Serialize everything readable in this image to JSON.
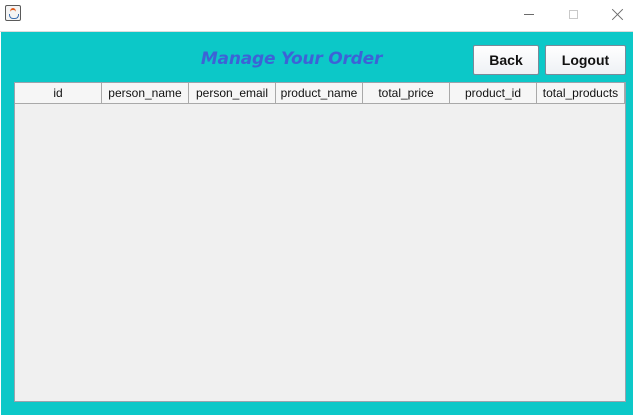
{
  "window": {
    "icon": "java-cup-icon",
    "controls": [
      "minimize-icon",
      "maximize-icon",
      "close-icon"
    ]
  },
  "header": {
    "title": "Manage Your Order",
    "title_color": "#3d63d6",
    "background_color": "#0cc8c8"
  },
  "buttons": {
    "back_label": "Back",
    "logout_label": "Logout"
  },
  "table": {
    "columns": [
      "id",
      "person_name",
      "person_email",
      "product_name",
      "total_price",
      "product_id",
      "total_products"
    ],
    "rows": []
  }
}
